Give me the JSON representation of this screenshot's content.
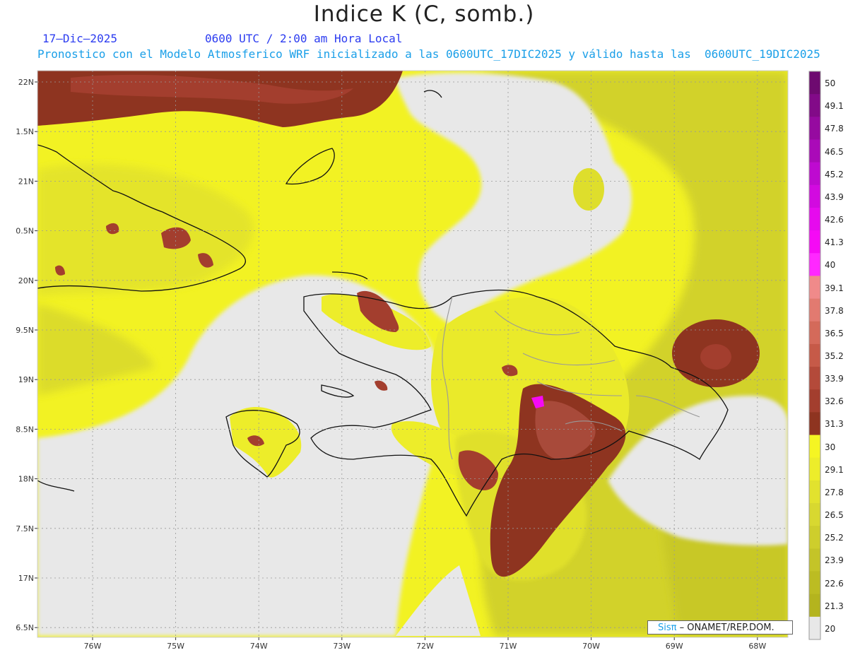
{
  "title": "Indice K (C, somb.)",
  "date": "17–Dic–2025",
  "time": "0600 UTC / 2:00 am Hora Local",
  "subtitle": "Pronostico con el Modelo Atmosferico WRF inicializado a las 0600UTC_17DIC2025 y válido hasta las  0600UTC_19DIC2025",
  "credit": {
    "brand": "Sisπ",
    "text": " – ONAMET/REP.DOM."
  },
  "lat_labels": [
    "22N",
    "1.5N",
    "21N",
    "0.5N",
    "20N",
    "9.5N",
    "19N",
    "8.5N",
    "18N",
    "7.5N",
    "17N",
    "6.5N"
  ],
  "lon_labels": [
    "76W",
    "75W",
    "74W",
    "73W",
    "72W",
    "71W",
    "70W",
    "69W",
    "68W"
  ],
  "colorbar": {
    "labels": [
      "50",
      "49.1",
      "47.8",
      "46.5",
      "45.2",
      "43.9",
      "42.6",
      "41.3",
      "40",
      "39.1",
      "37.8",
      "36.5",
      "35.2",
      "33.9",
      "32.6",
      "31.3",
      "30",
      "29.1",
      "27.8",
      "26.5",
      "25.2",
      "23.9",
      "22.6",
      "21.3",
      "20"
    ],
    "colors": [
      "#6e0a70",
      "#820a88",
      "#960aa0",
      "#aa0ab8",
      "#be0ad0",
      "#d20ae0",
      "#e60aee",
      "#f50af5",
      "#ff28ff",
      "#f08a8a",
      "#e27a70",
      "#d46a5a",
      "#c65a48",
      "#b44a3a",
      "#a33e2e",
      "#8e3420",
      "#f5f523",
      "#eded2a",
      "#e2e22e",
      "#d8d830",
      "#cece2c",
      "#c4c428",
      "#bcbc22",
      "#b4b41e",
      "#e8e8e8"
    ]
  },
  "colors": {
    "background_field": "#e8e8e8",
    "high_k": "#8e3420",
    "title_blue": "#2c3cf0",
    "subtitle_cyan": "#1a9fe8"
  }
}
